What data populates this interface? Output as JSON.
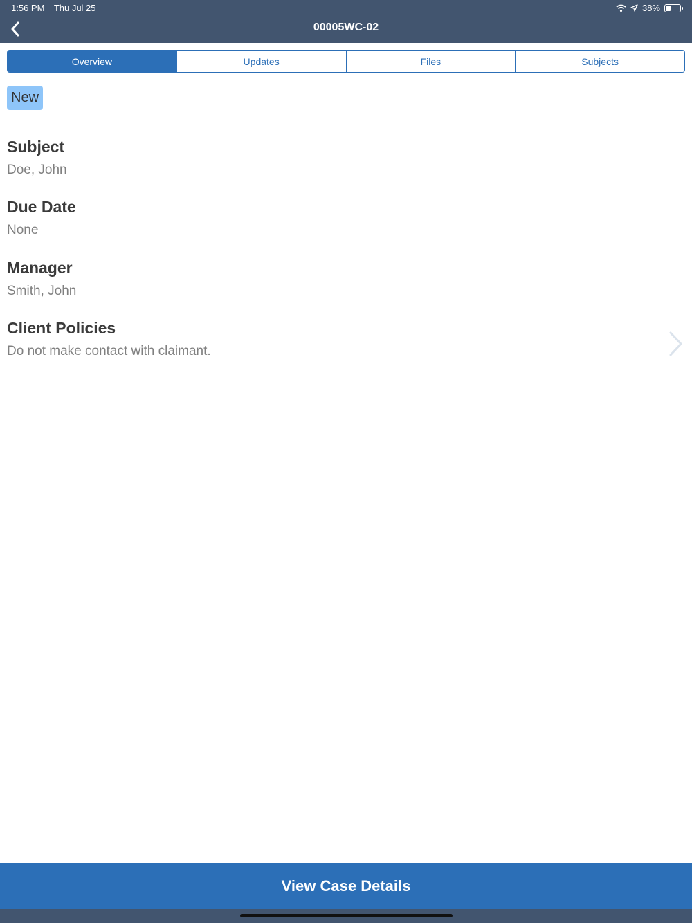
{
  "status_bar": {
    "time": "1:56 PM",
    "date": "Thu Jul 25",
    "battery_text": "38%",
    "battery_level": 0.38,
    "icons": [
      "wifi-icon",
      "location-arrow-icon",
      "battery-icon"
    ]
  },
  "nav": {
    "title": "00005WC-02",
    "back_icon": "chevron-left-icon"
  },
  "tabs": [
    {
      "label": "Overview",
      "active": true
    },
    {
      "label": "Updates",
      "active": false
    },
    {
      "label": "Files",
      "active": false
    },
    {
      "label": "Subjects",
      "active": false
    }
  ],
  "status_badge": "New",
  "fields": {
    "subject": {
      "label": "Subject",
      "value": "Doe, John"
    },
    "due_date": {
      "label": "Due Date",
      "value": "None"
    },
    "manager": {
      "label": "Manager",
      "value": "Smith, John"
    },
    "client_policies": {
      "label": "Client Policies",
      "value": "Do not make contact with claimant."
    }
  },
  "cta": {
    "label": "View Case Details"
  },
  "colors": {
    "header_bg": "#42556f",
    "accent": "#2c6fb7",
    "badge_bg": "#8ec5f9"
  }
}
